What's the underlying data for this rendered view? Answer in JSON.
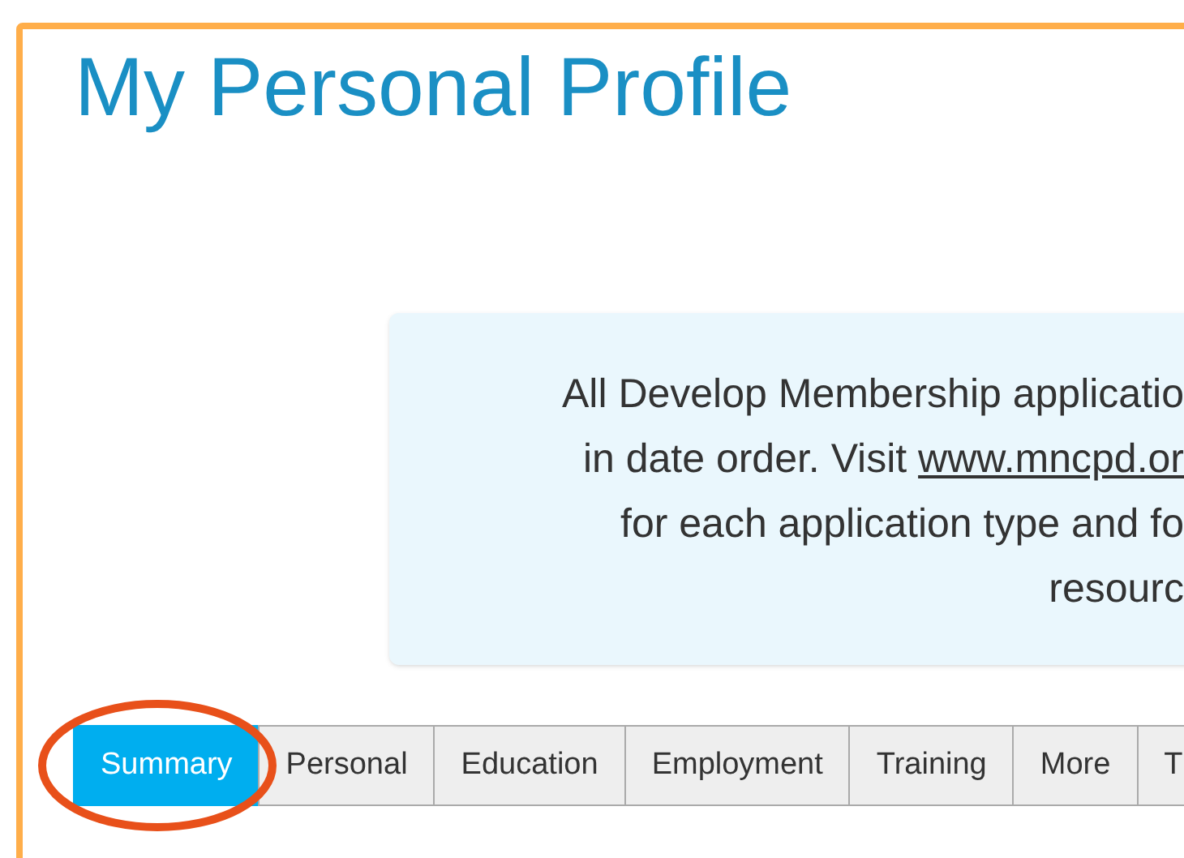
{
  "page": {
    "title": "My Personal Profile"
  },
  "notice": {
    "lines": [
      {
        "text": "All Develop Membership applicatio"
      },
      {
        "text": "in date order. Visit ",
        "link": "www.mncpd.or"
      },
      {
        "text": "for each application type and fo"
      },
      {
        "text": "resourc"
      }
    ]
  },
  "tabs": [
    {
      "label": "Summary",
      "selected": true
    },
    {
      "label": "Personal",
      "selected": false
    },
    {
      "label": "Education",
      "selected": false
    },
    {
      "label": "Employment",
      "selected": false
    },
    {
      "label": "Training",
      "selected": false
    },
    {
      "label": "More",
      "selected": false
    },
    {
      "label": "T",
      "selected": false
    }
  ]
}
